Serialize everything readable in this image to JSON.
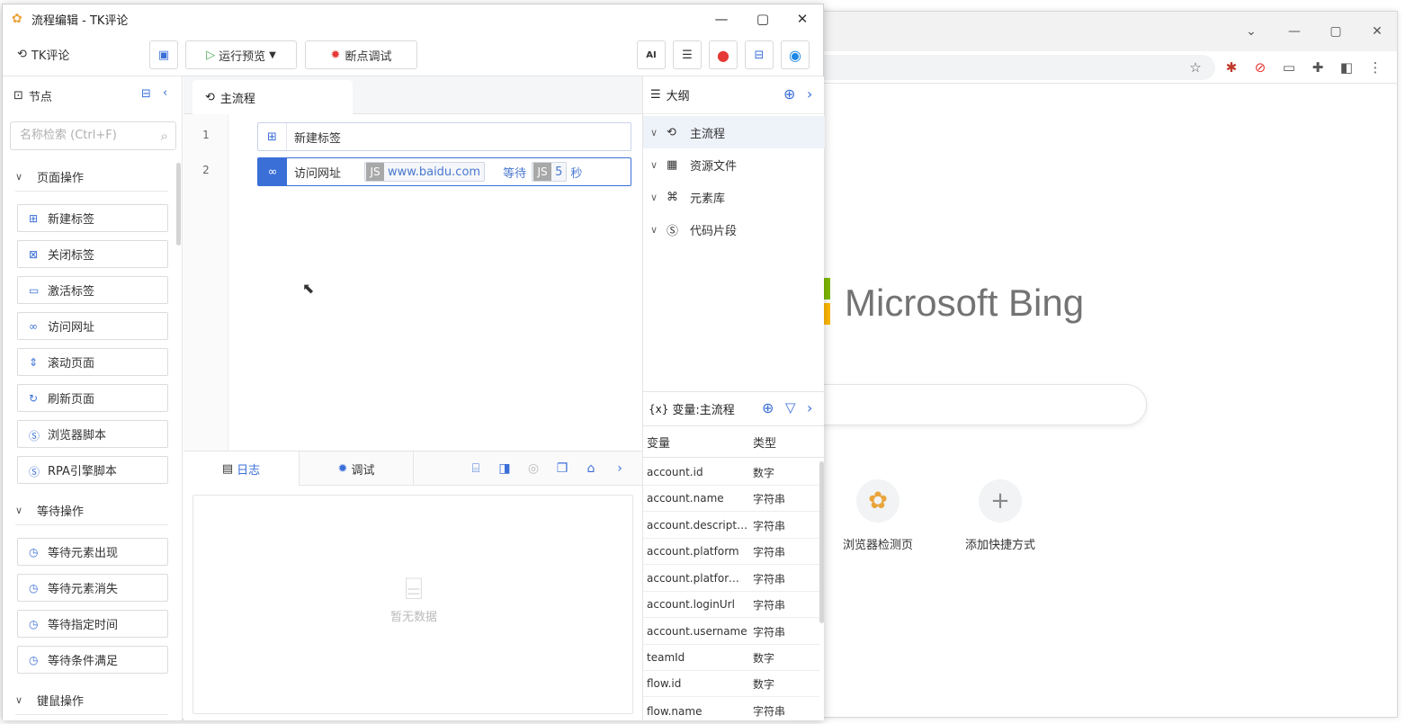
{
  "browser": {
    "brand": "Microsoft Bing",
    "shortcuts": [
      {
        "label": "浏览器检测页"
      },
      {
        "label": "添加快捷方式"
      }
    ]
  },
  "app": {
    "window_title": "流程编辑 - TK评论",
    "toolbar": {
      "project_name": "TK评论",
      "run_preview": "运行预览",
      "debug": "断点调试",
      "ai_label": "AI"
    },
    "left_panel": {
      "title": "节点",
      "search_placeholder": "名称检索 (Ctrl+F)",
      "groups": [
        {
          "label": "页面操作",
          "items": [
            "新建标签",
            "关闭标签",
            "激活标签",
            "访问网址",
            "滚动页面",
            "刷新页面",
            "浏览器脚本",
            "RPA引擎脚本"
          ]
        },
        {
          "label": "等待操作",
          "items": [
            "等待元素出现",
            "等待元素消失",
            "等待指定时间",
            "等待条件满足"
          ]
        },
        {
          "label": "键鼠操作",
          "items": []
        }
      ]
    },
    "editor": {
      "tab": "主流程",
      "steps": [
        {
          "line": "1",
          "label": "新建标签"
        },
        {
          "line": "2",
          "label": "访问网址",
          "url": "www.baidu.com",
          "wait_label": "等待",
          "wait_value": "5",
          "unit": "秒"
        }
      ]
    },
    "bottom_panel": {
      "tabs": [
        "日志",
        "调试"
      ],
      "empty_text": "暂无数据"
    },
    "outline": {
      "title": "大纲",
      "items": [
        "主流程",
        "资源文件",
        "元素库",
        "代码片段"
      ]
    },
    "variables": {
      "title": "变量:主流程",
      "col_name": "变量",
      "col_type": "类型",
      "rows": [
        {
          "name": "account.id",
          "type": "数字"
        },
        {
          "name": "account.name",
          "type": "字符串"
        },
        {
          "name": "account.descripti...",
          "type": "字符串"
        },
        {
          "name": "account.platform",
          "type": "字符串"
        },
        {
          "name": "account.platform...",
          "type": "字符串"
        },
        {
          "name": "account.loginUrl",
          "type": "字符串"
        },
        {
          "name": "account.username",
          "type": "字符串"
        },
        {
          "name": "teamId",
          "type": "数字"
        },
        {
          "name": "flow.id",
          "type": "数字"
        },
        {
          "name": "flow.name",
          "type": "字符串"
        }
      ]
    },
    "colors": {
      "accent": "#3a6fd8",
      "record": "#e53935"
    }
  }
}
